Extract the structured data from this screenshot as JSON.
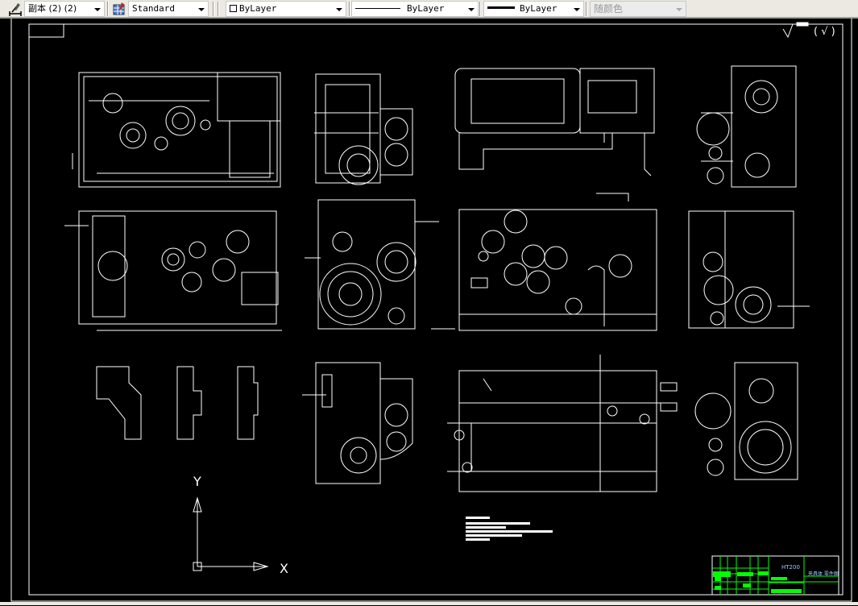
{
  "toolbar": {
    "dimstyle": "副本 (2) (2)",
    "tablestyle": "Standard",
    "layer_color": "ByLayer",
    "linetype": "ByLayer",
    "lineweight": "ByLayer",
    "plotstyle": "随颜色"
  },
  "drawing": {
    "roughness_symbol": "( √ )",
    "title_block_code": "HT200",
    "title_block_name": "夹具体 零件图",
    "ucs_x": "X",
    "ucs_y": "Y"
  },
  "colors": {
    "background": "#000000",
    "lines": "#ffffff",
    "title_block": "#00ff00"
  }
}
